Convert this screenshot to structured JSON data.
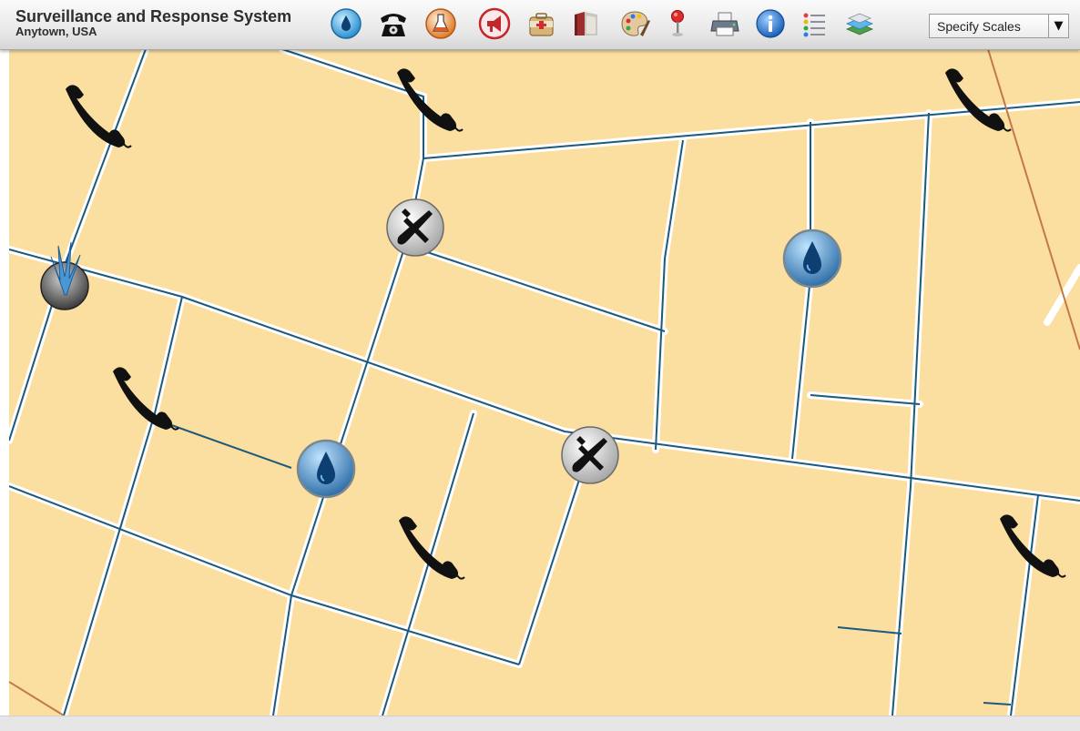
{
  "header": {
    "title": "Surveillance and Response System",
    "subtitle": "Anytown, USA"
  },
  "toolbar": {
    "tools": [
      {
        "icon": "water-drop-icon"
      },
      {
        "icon": "telephone-icon"
      },
      {
        "icon": "lab-flask-icon"
      },
      {
        "icon": "megaphone-icon"
      },
      {
        "icon": "first-aid-kit-icon"
      },
      {
        "icon": "book-icon"
      },
      {
        "icon": "paint-palette-icon"
      },
      {
        "icon": "map-pin-icon"
      },
      {
        "icon": "printer-icon"
      },
      {
        "icon": "info-icon"
      },
      {
        "icon": "list-icon"
      },
      {
        "icon": "layers-icon"
      }
    ],
    "scale_select": {
      "value": "Specify Scales",
      "arrow": "▼"
    }
  },
  "map": {
    "markers": [
      {
        "type": "telephone"
      },
      {
        "type": "telephone"
      },
      {
        "type": "telephone"
      },
      {
        "type": "telephone"
      },
      {
        "type": "telephone"
      },
      {
        "type": "telephone"
      },
      {
        "type": "repair"
      },
      {
        "type": "repair"
      },
      {
        "type": "water"
      },
      {
        "type": "water"
      },
      {
        "type": "vegetation"
      }
    ]
  },
  "colors": {
    "parcel": "#fbdfa0",
    "road": "#ffffff",
    "pipe": "#1b5a7c",
    "highway": "#c2784a",
    "water_marker": "#2f6fa8",
    "toolbar_bg": "#e6e6e6"
  }
}
